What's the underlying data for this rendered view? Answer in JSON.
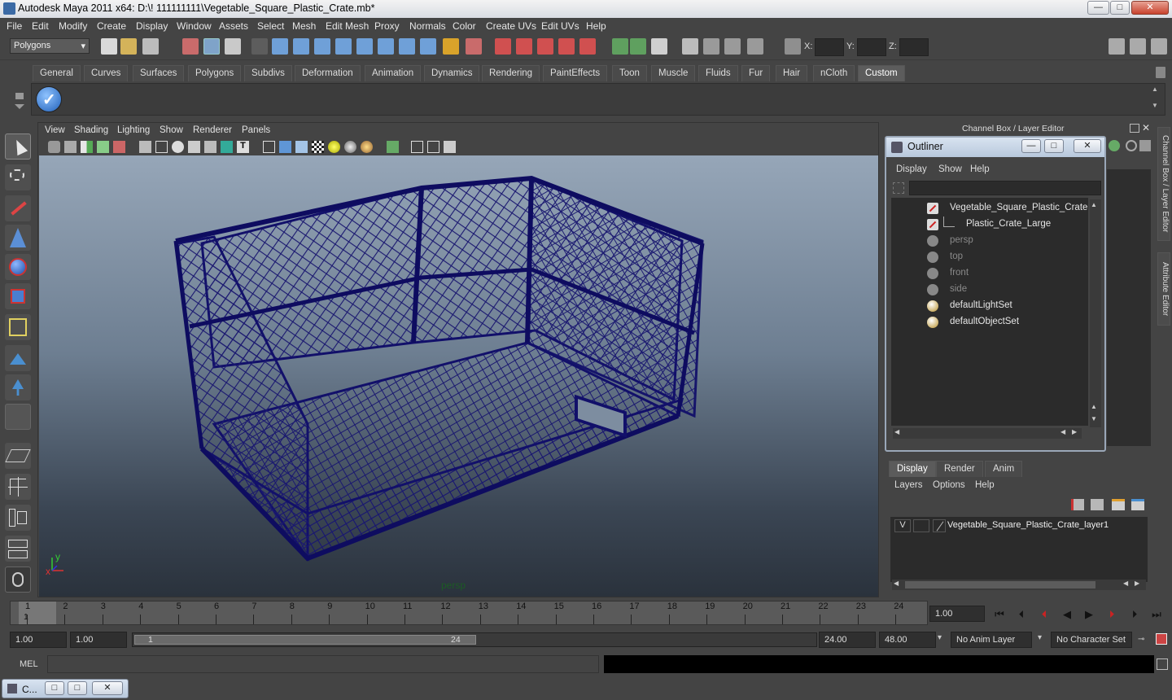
{
  "window": {
    "title": "Autodesk Maya 2011 x64: D:\\! 111111111\\Vegetable_Square_Plastic_Crate.mb*",
    "min_label": "—",
    "max_label": "□",
    "close_label": "✕"
  },
  "menubar": [
    "File",
    "Edit",
    "Modify",
    "Create",
    "Display",
    "Window",
    "Assets",
    "Select",
    "Mesh",
    "Edit Mesh",
    "Proxy",
    "Normals",
    "Color",
    "Create UVs",
    "Edit UVs",
    "Help"
  ],
  "toolbar": {
    "mode": "Polygons",
    "x_label": "X:",
    "y_label": "Y:",
    "z_label": "Z:"
  },
  "shelf_tabs": [
    "General",
    "Curves",
    "Surfaces",
    "Polygons",
    "Subdivs",
    "Deformation",
    "Animation",
    "Dynamics",
    "Rendering",
    "PaintEffects",
    "Toon",
    "Muscle",
    "Fluids",
    "Fur",
    "Hair",
    "nCloth",
    "Custom"
  ],
  "active_shelf_tab": "Custom",
  "viewport": {
    "menu": [
      "View",
      "Shading",
      "Lighting",
      "Show",
      "Renderer",
      "Panels"
    ],
    "camera": "persp",
    "axis_x": "x",
    "axis_y": "y"
  },
  "channel_box": {
    "title": "Channel Box / Layer Editor"
  },
  "right_tabs": {
    "channel_box": "Channel Box / Layer Editor",
    "attribute_editor": "Attribute Editor"
  },
  "outliner": {
    "title": "Outliner",
    "menu": [
      "Display",
      "Show",
      "Help"
    ],
    "items": [
      {
        "name": "Vegetable_Square_Plastic_Crate",
        "indent": 0,
        "dim": false,
        "type": "mesh"
      },
      {
        "name": "Plastic_Crate_Large",
        "indent": 1,
        "dim": false,
        "type": "mesh"
      },
      {
        "name": "persp",
        "indent": 0,
        "dim": true,
        "type": "camera"
      },
      {
        "name": "top",
        "indent": 0,
        "dim": true,
        "type": "camera"
      },
      {
        "name": "front",
        "indent": 0,
        "dim": true,
        "type": "camera"
      },
      {
        "name": "side",
        "indent": 0,
        "dim": true,
        "type": "camera"
      },
      {
        "name": "defaultLightSet",
        "indent": 0,
        "dim": false,
        "type": "set"
      },
      {
        "name": "defaultObjectSet",
        "indent": 0,
        "dim": false,
        "type": "set"
      }
    ]
  },
  "layer_editor": {
    "tabs": [
      "Display",
      "Render",
      "Anim"
    ],
    "active_tab": "Display",
    "menu": [
      "Layers",
      "Options",
      "Help"
    ],
    "layer": {
      "visible": "V",
      "name": "Vegetable_Square_Plastic_Crate_layer1"
    }
  },
  "timeline": {
    "ticks": [
      "1",
      "2",
      "3",
      "4",
      "5",
      "6",
      "7",
      "8",
      "9",
      "10",
      "11",
      "12",
      "13",
      "14",
      "15",
      "16",
      "17",
      "18",
      "19",
      "20",
      "21",
      "22",
      "23",
      "24"
    ],
    "current_frame_marker": "1",
    "current_time": "1.00"
  },
  "range": {
    "start": "1.00",
    "playback_start": "1.00",
    "slider_start": "1",
    "slider_end": "24",
    "playback_end": "24.00",
    "end": "48.00",
    "anim_layer": "No Anim Layer",
    "character_set": "No Character Set"
  },
  "command_line": {
    "label": "MEL"
  },
  "taskbar": {
    "item": "C..."
  }
}
